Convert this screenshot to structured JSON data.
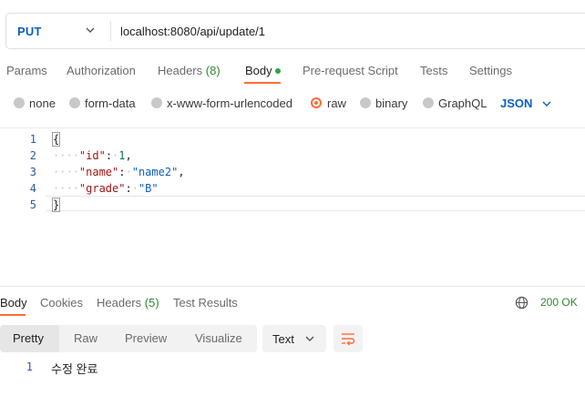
{
  "request": {
    "method": "PUT",
    "url": "localhost:8080/api/update/1"
  },
  "request_tabs": [
    {
      "label": "Params"
    },
    {
      "label": "Authorization"
    },
    {
      "label": "Headers",
      "count": "(8)"
    },
    {
      "label": "Body"
    },
    {
      "label": "Pre-request Script"
    },
    {
      "label": "Tests"
    },
    {
      "label": "Settings"
    }
  ],
  "body_types": [
    "none",
    "form-data",
    "x-www-form-urlencoded",
    "raw",
    "binary",
    "GraphQL"
  ],
  "selected_body_type": "raw",
  "format": "JSON",
  "editor": {
    "line_numbers": [
      "1",
      "2",
      "3",
      "4",
      "5"
    ],
    "open_brace": "{",
    "close_brace": "}",
    "fields": [
      {
        "key": "\"id\"",
        "value": "1",
        "sep": ","
      },
      {
        "key": "\"name\"",
        "value": "\"name2\"",
        "sep": ","
      },
      {
        "key": "\"grade\"",
        "value": "\"B\"",
        "sep": ""
      }
    ]
  },
  "response": {
    "tabs": [
      {
        "label": "Body"
      },
      {
        "label": "Cookies"
      },
      {
        "label": "Headers",
        "count": "(5)"
      },
      {
        "label": "Test Results"
      }
    ],
    "status": "200 OK",
    "view_modes": [
      "Pretty",
      "Raw",
      "Preview",
      "Visualize"
    ],
    "text_format": "Text",
    "output_line_number": "1",
    "output": "수정 완료"
  },
  "colors": {
    "accent": "#ff6c37",
    "method": "#0b5ec4",
    "status_ok": "#2f8a2f"
  },
  "icons": [
    "chevron-down-icon",
    "globe-icon",
    "wrap-lines-icon"
  ]
}
